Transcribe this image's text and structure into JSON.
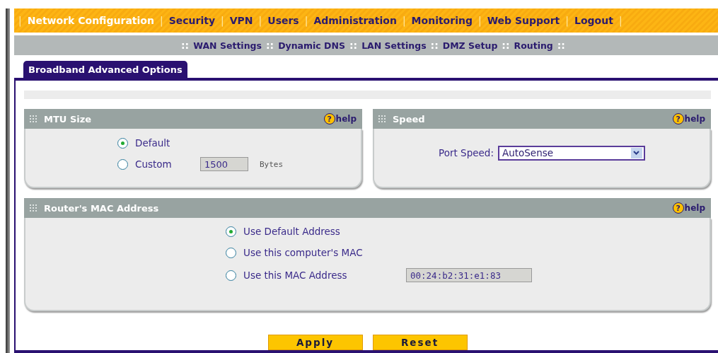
{
  "main_nav": [
    {
      "kind": "separator",
      "text": "|"
    },
    {
      "kind": "link",
      "text": "Network Configuration",
      "selected": true
    },
    {
      "kind": "separator",
      "text": "|"
    },
    {
      "kind": "link",
      "text": "Security",
      "selected": false
    },
    {
      "kind": "separator",
      "text": "|"
    },
    {
      "kind": "link",
      "text": "VPN",
      "selected": false
    },
    {
      "kind": "separator",
      "text": "|"
    },
    {
      "kind": "link",
      "text": "Users",
      "selected": false
    },
    {
      "kind": "separator",
      "text": "|"
    },
    {
      "kind": "link",
      "text": "Administration",
      "selected": false
    },
    {
      "kind": "separator",
      "text": "|"
    },
    {
      "kind": "link",
      "text": "Monitoring",
      "selected": false
    },
    {
      "kind": "separator",
      "text": "|"
    },
    {
      "kind": "link",
      "text": "Web Support",
      "selected": false
    },
    {
      "kind": "separator",
      "text": "|"
    },
    {
      "kind": "link",
      "text": "Logout",
      "selected": false
    },
    {
      "kind": "separator",
      "text": "|"
    }
  ],
  "sub_nav": [
    {
      "kind": "separator",
      "text": "::"
    },
    {
      "kind": "link",
      "text": "WAN Settings"
    },
    {
      "kind": "separator",
      "text": "::"
    },
    {
      "kind": "link",
      "text": "Dynamic DNS"
    },
    {
      "kind": "separator",
      "text": "::"
    },
    {
      "kind": "link",
      "text": "LAN Settings"
    },
    {
      "kind": "separator",
      "text": "::"
    },
    {
      "kind": "link",
      "text": "DMZ Setup"
    },
    {
      "kind": "separator",
      "text": "::"
    },
    {
      "kind": "link",
      "text": "Routing"
    },
    {
      "kind": "separator",
      "text": "::"
    }
  ],
  "tabs": [
    {
      "label": "Broadband Advanced Options",
      "selected": true
    }
  ],
  "mtu": {
    "title": "MTU Size",
    "help": {
      "icon": "?",
      "label": "help"
    },
    "options": [
      {
        "label": "Default",
        "selected": true
      },
      {
        "label": "Custom",
        "selected": false,
        "value": "1500",
        "unit": "Bytes"
      }
    ]
  },
  "speed": {
    "title": "Speed",
    "help": {
      "icon": "?",
      "label": "help"
    },
    "label": "Port Speed:",
    "value": "AutoSense"
  },
  "mac": {
    "title": "Router's MAC Address",
    "help": {
      "icon": "?",
      "label": "help"
    },
    "options": [
      {
        "label": "Use Default Address",
        "selected": true
      },
      {
        "label": "Use this computer's MAC",
        "selected": false
      },
      {
        "label": "Use this MAC Address",
        "selected": false,
        "value": "00:24:b2:31:e1:83"
      }
    ]
  },
  "buttons": [
    "Apply",
    "Reset"
  ]
}
